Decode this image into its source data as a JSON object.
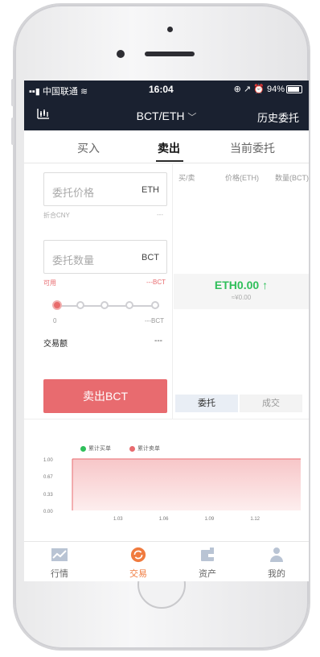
{
  "status_bar": {
    "carrier": "中国联通",
    "time": "16:04",
    "battery": "94%"
  },
  "nav": {
    "pair": "BCT/ETH",
    "history": "历史委托"
  },
  "tabs": [
    {
      "label": "买入"
    },
    {
      "label": "卖出"
    },
    {
      "label": "当前委托"
    }
  ],
  "order_form": {
    "price_placeholder": "委托价格",
    "price_unit": "ETH",
    "cny_label": "折合CNY",
    "cny_value": "---",
    "qty_placeholder": "委托数量",
    "qty_unit": "BCT",
    "available_label": "可用",
    "available_value": "---BCT",
    "slider_min": "0",
    "slider_max": "---BCT",
    "trade_amount_label": "交易额",
    "trade_amount_value": "---",
    "sell_button": "卖出BCT"
  },
  "orderbook": {
    "headers": [
      "买/卖",
      "价格(ETH)",
      "数量(BCT)"
    ],
    "last_price": "ETH0.00",
    "last_price_cny": "≈¥0.00",
    "segments": [
      "委托",
      "成交"
    ]
  },
  "depth_chart": {
    "legend": [
      "累计买单",
      "累计卖单"
    ],
    "colors": {
      "buy": "#2fbf5a",
      "sell": "#e86b6f"
    }
  },
  "chart_data": {
    "type": "area",
    "series": [
      {
        "name": "累计买单",
        "x": [],
        "values": []
      },
      {
        "name": "累计卖单",
        "x": [
          1.0,
          1.03,
          1.06,
          1.09,
          1.12,
          1.15
        ],
        "values": [
          1.0,
          1.0,
          1.0,
          1.0,
          1.0,
          1.0
        ]
      }
    ],
    "x_ticks": [
      "1.03",
      "1.06",
      "1.09",
      "1.12"
    ],
    "y_ticks": [
      "0.00",
      "0.33",
      "0.67",
      "1.00"
    ],
    "xlim": [
      1.0,
      1.15
    ],
    "ylim": [
      0.0,
      1.0
    ],
    "legend_position": "top-left"
  },
  "bottom_nav": [
    {
      "label": "行情",
      "icon": "chart-line-icon"
    },
    {
      "label": "交易",
      "icon": "refresh-circle-icon"
    },
    {
      "label": "资产",
      "icon": "wallet-icon"
    },
    {
      "label": "我的",
      "icon": "person-icon"
    }
  ],
  "colors": {
    "nav_bg": "#1a2130",
    "sell": "#e86b6f",
    "buy": "#2fbf5a",
    "active_tab": "#f07b3f"
  }
}
